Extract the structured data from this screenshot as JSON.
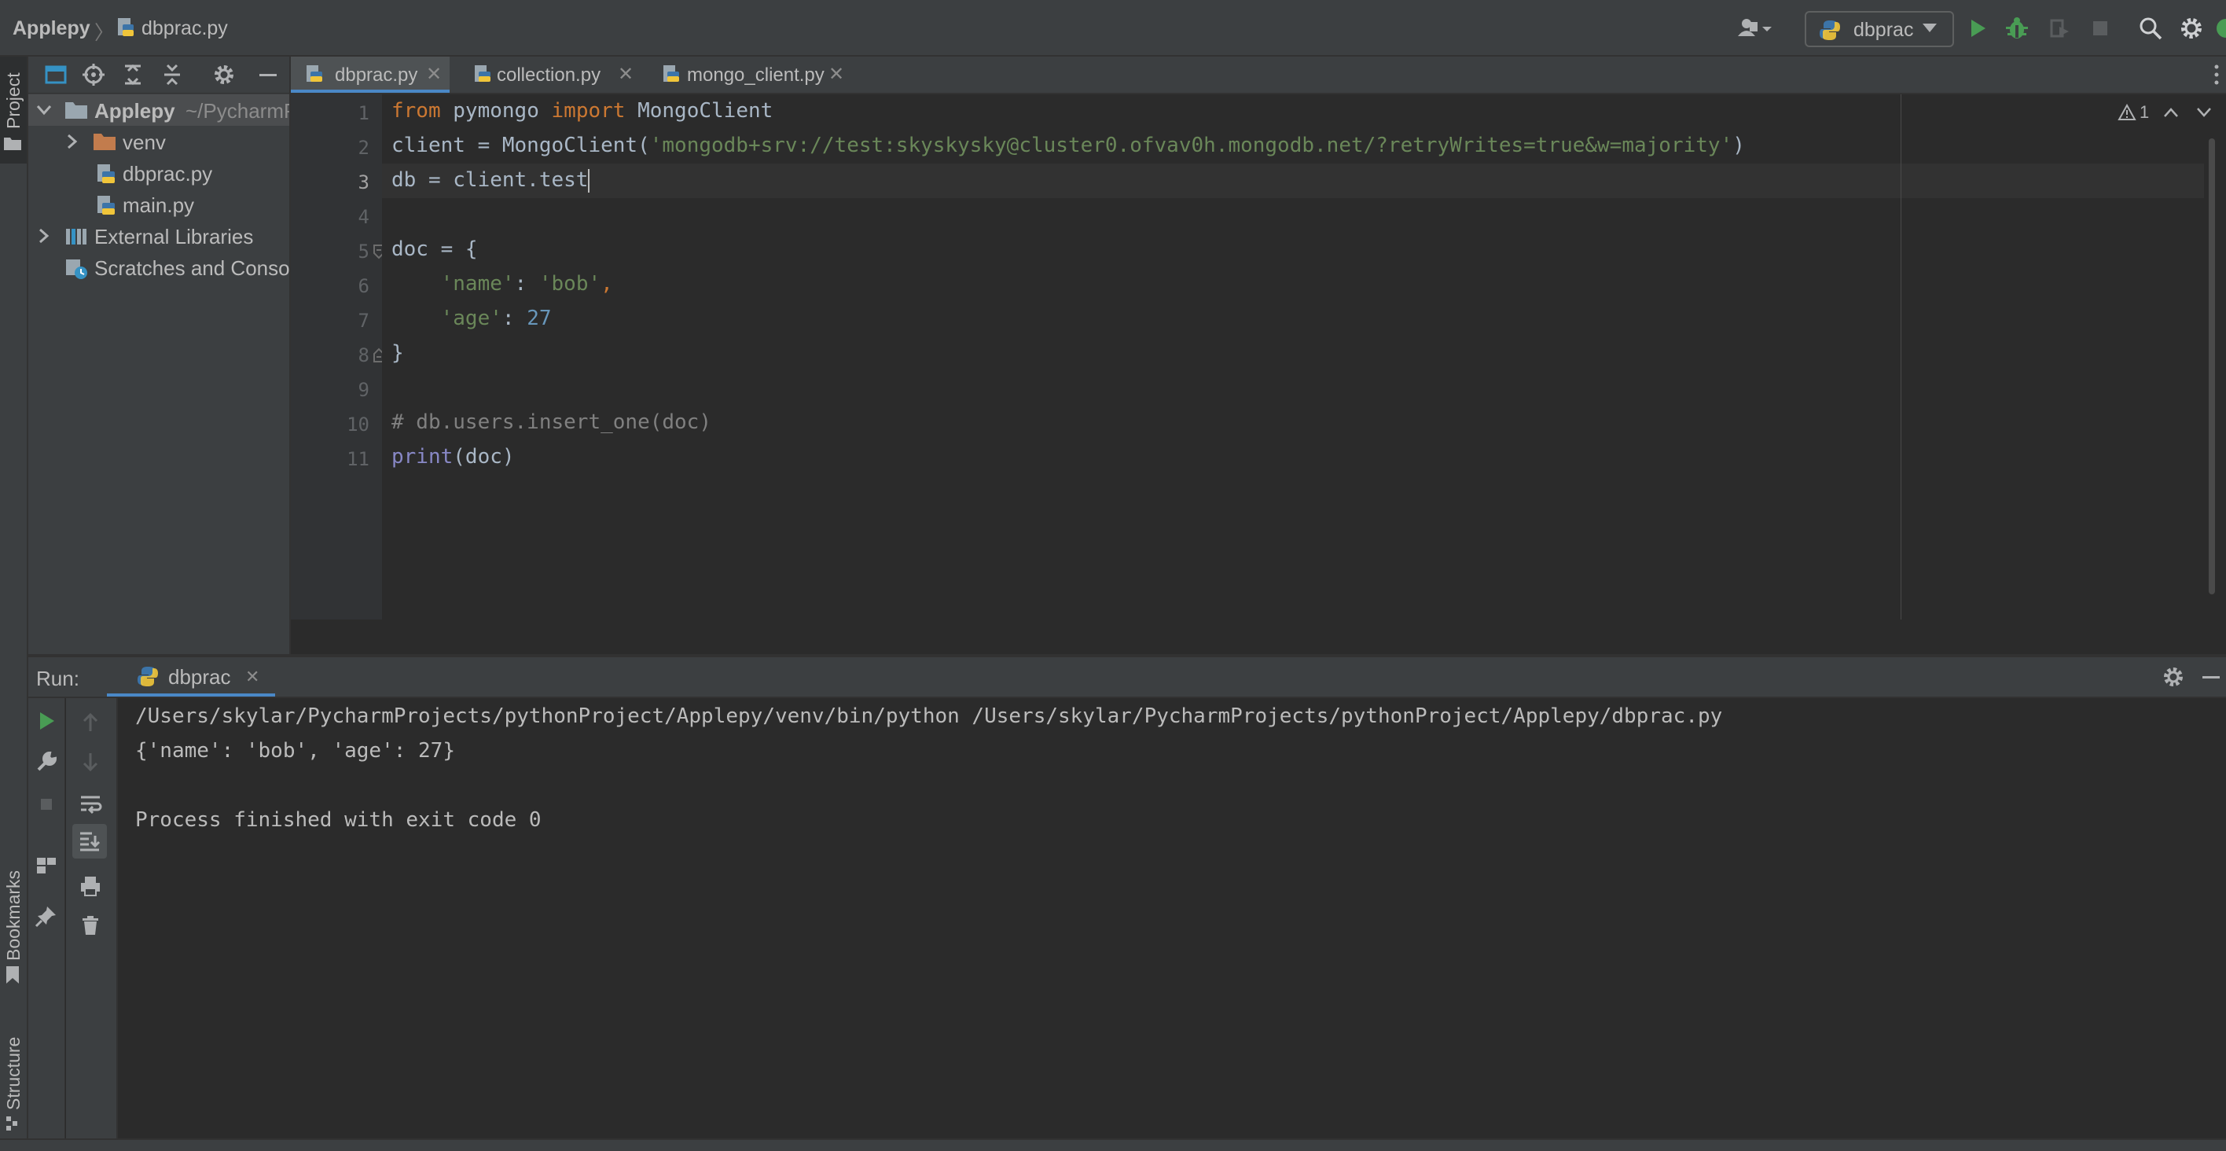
{
  "titlebar": {
    "project": "Applepy",
    "file": "dbprac.py",
    "run_config": "dbprac",
    "icons": [
      "account-icon",
      "run-icon",
      "debug-icon",
      "coverage-icon",
      "stop-icon",
      "search-icon",
      "settings-icon"
    ]
  },
  "left_strip": {
    "project_label": "Project",
    "bookmarks_label": "Bookmarks",
    "structure_label": "Structure"
  },
  "project_tree": {
    "root_name": "Applepy",
    "root_path": "~/PycharmProjects/pythonProject/Applepy",
    "items": [
      {
        "label": "venv"
      },
      {
        "label": "dbprac.py"
      },
      {
        "label": "main.py"
      },
      {
        "label": "External Libraries"
      },
      {
        "label": "Scratches and Consoles"
      }
    ]
  },
  "editor": {
    "tabs": [
      {
        "label": "dbprac.py"
      },
      {
        "label": "collection.py"
      },
      {
        "label": "mongo_client.py"
      }
    ],
    "warnings_count": "1",
    "line_numbers": [
      "1",
      "2",
      "3",
      "4",
      "5",
      "6",
      "7",
      "8",
      "9",
      "10",
      "11"
    ],
    "code": {
      "l1_kw1": "from",
      "l1_mod": " pymongo ",
      "l1_kw2": "import",
      "l1_name": " MongoClient",
      "l2_pre": "client = MongoClient(",
      "l2_str": "'mongodb+srv://test:skyskysky@cluster0.ofvav0h.mongodb.net/?retryWrites=true&w=majority'",
      "l2_post": ")",
      "l3": "db = client.test",
      "l5": "doc = {",
      "l6_key": "'name'",
      "l6_colon": ": ",
      "l6_val": "'bob'",
      "l6_comma": ",",
      "l7_key": "'age'",
      "l7_colon": ": ",
      "l7_val": "27",
      "l8": "}",
      "l10": "# db.users.insert_one(doc)",
      "l11_fn": "print",
      "l11_rest": "(doc)"
    }
  },
  "run_panel": {
    "label": "Run:",
    "tab": "dbprac",
    "output": [
      "/Users/skylar/PycharmProjects/pythonProject/Applepy/venv/bin/python /Users/skylar/PycharmProjects/pythonProject/Applepy/dbprac.py",
      "{'name': 'bob', 'age': 27}",
      "",
      "Process finished with exit code 0"
    ]
  },
  "colors": {
    "background": "#2b2b2b",
    "panel": "#3c3f41",
    "keyword": "#cc7832",
    "string": "#6a8759",
    "number": "#6897bb",
    "run_green": "#499c54",
    "folder_orange": "#c27c4d"
  }
}
